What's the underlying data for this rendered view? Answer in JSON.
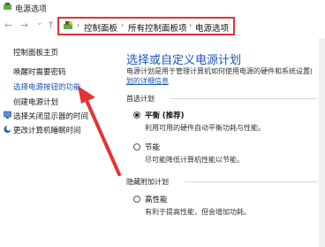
{
  "window": {
    "title": "电源选项"
  },
  "nav": {
    "back": "←",
    "forward": "→",
    "dropdown": "⌄",
    "up": "↑"
  },
  "breadcrumb": {
    "items": [
      "控制面板",
      "所有控制面板项",
      "电源选项"
    ]
  },
  "sidebar": {
    "items": [
      {
        "label": "控制面板主页"
      },
      {
        "label": "唤醒时需要密码"
      },
      {
        "label": "选择电源按钮的功能"
      },
      {
        "label": "创建电源计划"
      },
      {
        "label": "选择关闭显示器的时间"
      },
      {
        "label": "更改计算机睡眠时间"
      }
    ]
  },
  "main": {
    "heading": "选择或自定义电源计划",
    "description": "电源计划是用于管理计算机如何使用电源的硬件和系统设置(",
    "link": "划的详细信息",
    "preferred_title": "首选计划",
    "plans": [
      {
        "name": "平衡",
        "badge": "(推荐)",
        "desc": "利用可用的硬件自动平衡功耗与性能。",
        "selected": true
      },
      {
        "name": "节能",
        "badge": "",
        "desc": "尽可能降低计算机性能以节能。",
        "selected": false
      }
    ],
    "hidden_title": "隐藏附加计划",
    "hidden_plans": [
      {
        "name": "高性能",
        "desc": "有利于提高性能，但会增加功耗。",
        "selected": false
      }
    ]
  },
  "colors": {
    "accent": "#1e56b3",
    "highlight_border": "#e53232",
    "arrow": "#e53232"
  }
}
